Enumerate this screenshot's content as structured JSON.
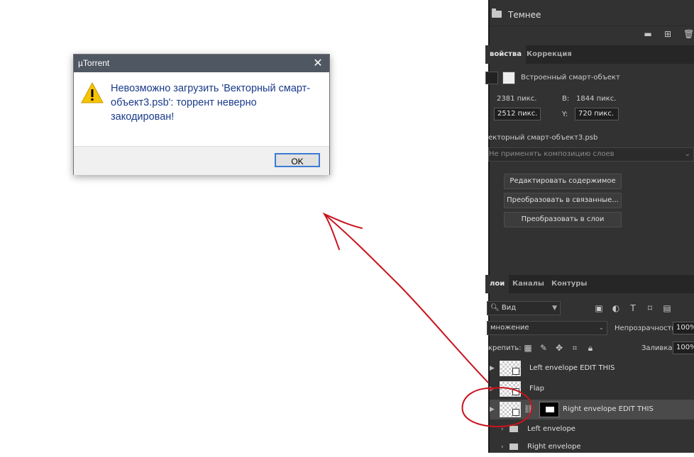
{
  "dialog": {
    "title": "µTorrent",
    "message": "Невозможно загрузить 'Векторный смарт-объект3.psb': торрент неверно закодирован!",
    "ok_label": "OK",
    "close_glyph": "✕",
    "icon": "warning-icon"
  },
  "ps": {
    "folder_label": "Темнее",
    "tabs": [
      "войства",
      "Коррекция"
    ],
    "smart_object_label": "Встроенный смарт-объект",
    "w_label": "",
    "w_value": "2381 пикс.",
    "h_label": "В:",
    "h_value": "1844 пикс.",
    "x_value": "2512 пикс.",
    "y_label": "Y:",
    "y_value": "720 пикс.",
    "filename": "екторный смарт-объект3.psb",
    "comp_select": "Не применять композицию слоев",
    "buttons": [
      "Редактировать содержимое",
      "Преобразовать в связанные...",
      "Преобразовать в слои"
    ],
    "layer_tabs": [
      "лои",
      "Каналы",
      "Контуры"
    ],
    "kind_filter": "Вид",
    "blend_mode": "множение",
    "opacity_label": "Непрозрачность:",
    "opacity_value": "100%",
    "lock_label": "крепить:",
    "fill_label": "Заливка:",
    "fill_value": "100%",
    "layers": [
      {
        "name": "Left envelope EDIT THIS"
      },
      {
        "name": "Flap"
      },
      {
        "name": "Right envelope EDIT THIS"
      },
      {
        "name": "Left envelope"
      },
      {
        "name": "Right envelope"
      }
    ]
  },
  "colors": {
    "dialog_text": "#1a3a8a",
    "titlebar": "#4f5762",
    "annotation_red": "#c8141e",
    "ps_bg": "#323232"
  }
}
